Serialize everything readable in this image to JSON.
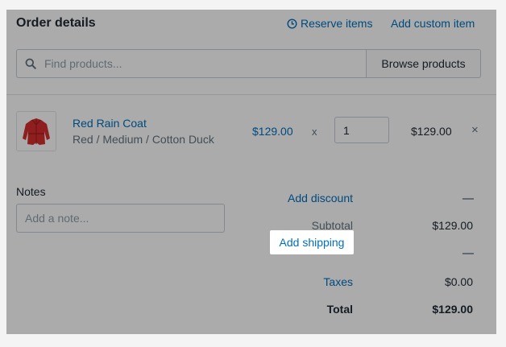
{
  "header": {
    "title": "Order details",
    "reserve_items_label": "Reserve items",
    "add_custom_item_label": "Add custom item"
  },
  "search": {
    "placeholder": "Find products...",
    "browse_label": "Browse products"
  },
  "line_item": {
    "product_name": "Red Rain Coat",
    "variant": "Red / Medium / Cotton Duck",
    "unit_price": "$129.00",
    "times": "x",
    "quantity": "1",
    "line_total": "$129.00",
    "remove_symbol": "×",
    "thumbnail_icon": "red-coat-image"
  },
  "notes": {
    "label": "Notes",
    "placeholder": "Add a note..."
  },
  "summary": {
    "add_discount_label": "Add discount",
    "subtotal_label": "Subtotal",
    "subtotal_value": "$129.00",
    "add_shipping_label": "Add shipping",
    "taxes_label": "Taxes",
    "taxes_value": "$0.00",
    "total_label": "Total",
    "total_value": "$129.00"
  },
  "colors": {
    "link": "#006fbb",
    "overlay": "rgba(0,0,0,0.33)",
    "coat": "#d62f2f"
  }
}
